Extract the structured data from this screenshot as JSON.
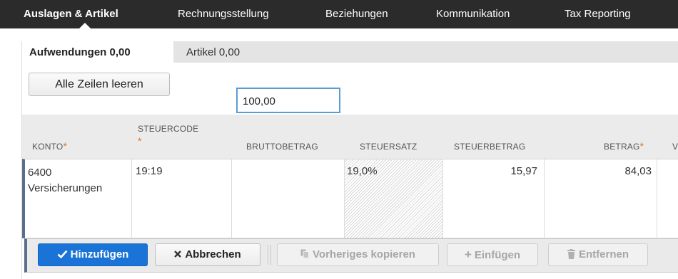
{
  "nav": {
    "items": [
      {
        "label": "Auslagen & Artikel",
        "active": true
      },
      {
        "label": "Rechnungsstellung",
        "active": false
      },
      {
        "label": "Beziehungen",
        "active": false
      },
      {
        "label": "Kommunikation",
        "active": false
      },
      {
        "label": "Tax Reporting",
        "active": false
      }
    ]
  },
  "subtabs": {
    "expenses": "Aufwendungen 0,00",
    "items": "Artikel 0,00"
  },
  "clear_button": "Alle Zeilen leeren",
  "table": {
    "headers": {
      "account": "KONTO",
      "taxcode": "STEUERCODE",
      "gross": "BRUTTOBETRAG",
      "taxrate": "STEUERSATZ",
      "taxamount": "STEUERBETRAG",
      "amount": "BETRAG",
      "next": "V"
    },
    "required_mark": "*",
    "row": {
      "account_line1": "6400",
      "account_line2": "Versicherungen",
      "taxcode": "19:19",
      "gross": "100,00",
      "taxrate": "19,0%",
      "taxamount": "15,97",
      "amount": "84,03"
    }
  },
  "actions": {
    "add": "Hinzufügen",
    "cancel": "Abbrechen",
    "copy_previous": "Vorheriges kopieren",
    "insert": "Einfügen",
    "remove": "Entfernen"
  },
  "colors": {
    "nav_bg": "#2b2b2b",
    "primary": "#1a73d6",
    "required": "#e2731a",
    "input_focus": "#5b9bd5"
  }
}
